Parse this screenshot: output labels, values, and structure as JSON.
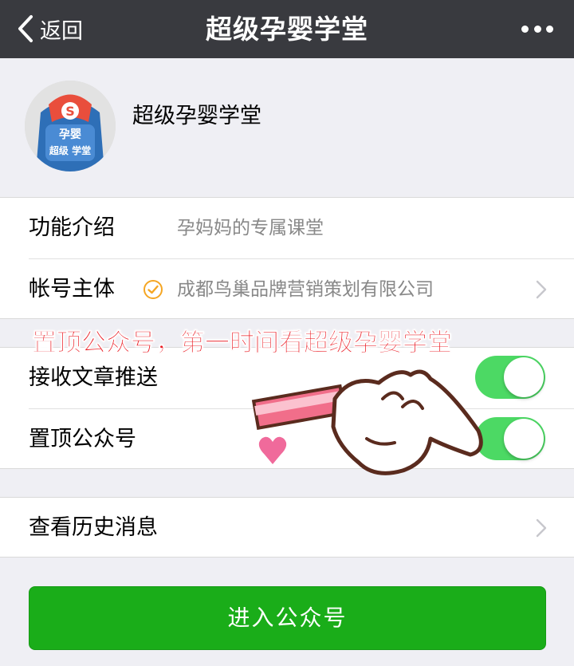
{
  "navbar": {
    "back_label": "返回",
    "title": "超级孕婴学堂",
    "more_icon": "more-dots-icon"
  },
  "profile": {
    "name": "超级孕婴学堂",
    "avatar_text_top": "孕婴",
    "avatar_text_bottom": "超级 学堂",
    "avatar_badge": "S"
  },
  "info": {
    "rows": [
      {
        "label": "功能介绍",
        "value": "孕妈妈的专属课堂"
      },
      {
        "label": "帐号主体",
        "value": "成都鸟巢品牌营销策划有限公司",
        "icon": "verified-icon"
      }
    ]
  },
  "promo": {
    "text": "置顶公众号，第一时间看超级孕婴学堂"
  },
  "settings": {
    "rows": [
      {
        "label": "接收文章推送",
        "enabled": true
      },
      {
        "label": "置顶公众号",
        "enabled": true
      }
    ]
  },
  "history": {
    "label": "查看历史消息"
  },
  "enter_button": {
    "label": "进入公众号"
  },
  "colors": {
    "navbar": "#393a3f",
    "accent_green": "#1aad19",
    "toggle_on": "#4cd964",
    "promo_red": "#ea1d25",
    "verified_orange": "#f5a623"
  }
}
